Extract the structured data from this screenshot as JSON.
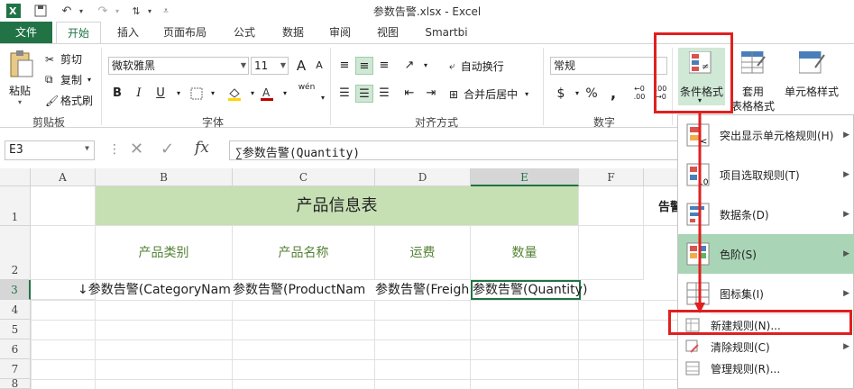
{
  "app": {
    "title": "参数告警.xlsx - Excel"
  },
  "tabs": [
    "文件",
    "开始",
    "插入",
    "页面布局",
    "公式",
    "数据",
    "审阅",
    "视图",
    "Smartbi"
  ],
  "ribbon": {
    "clipboard": {
      "paste": "粘贴",
      "cut": "剪切",
      "copy": "复制",
      "format_painter": "格式刷",
      "label": "剪贴板"
    },
    "font": {
      "name": "微软雅黑",
      "size": "11",
      "bold": "B",
      "italic": "I",
      "underline": "U",
      "grow": "A",
      "shrink": "A",
      "pinyin": "wén",
      "label": "字体"
    },
    "alignment": {
      "wrap": "自动换行",
      "merge": "合并后居中",
      "label": "对齐方式"
    },
    "number": {
      "format": "常规",
      "currency": "$",
      "percent": "%",
      "comma": ",",
      "label": "数字"
    },
    "styles": {
      "conditional": "条件格式",
      "table_l1": "套用",
      "table_l2": "表格格式",
      "cell_styles": "单元格样式"
    }
  },
  "formula_bar": {
    "name_box": "E3",
    "fx": "fx",
    "content": "∑参数告警(Quantity)"
  },
  "sheet": {
    "columns": [
      "A",
      "B",
      "C",
      "D",
      "E",
      "F"
    ],
    "rows": [
      "1",
      "2",
      "3",
      "4",
      "5",
      "6",
      "7",
      "8"
    ],
    "title": "产品信息表",
    "headers": [
      "产品类别",
      "产品名称",
      "运费",
      "数量"
    ],
    "row3": [
      "↓参数告警(CategoryNam",
      "参数告警(ProductNam",
      "参数告警(Freigh",
      "参数告警(Quantity)"
    ],
    "partial_label": "告警"
  },
  "menu": {
    "items": [
      {
        "label": "突出显示单元格规则(H)"
      },
      {
        "label": "项目选取规则(T)"
      },
      {
        "label": "数据条(D)"
      },
      {
        "label": "色阶(S)"
      },
      {
        "label": "图标集(I)"
      },
      {
        "label": "新建规则(N)..."
      },
      {
        "label": "清除规则(C)"
      },
      {
        "label": "管理规则(R)..."
      }
    ]
  },
  "colors": {
    "excel_green": "#217346",
    "header_fill": "#c6e0b4",
    "header_text": "#548235",
    "highlight": "#a9d5b6",
    "annotation_red": "#e02020"
  }
}
